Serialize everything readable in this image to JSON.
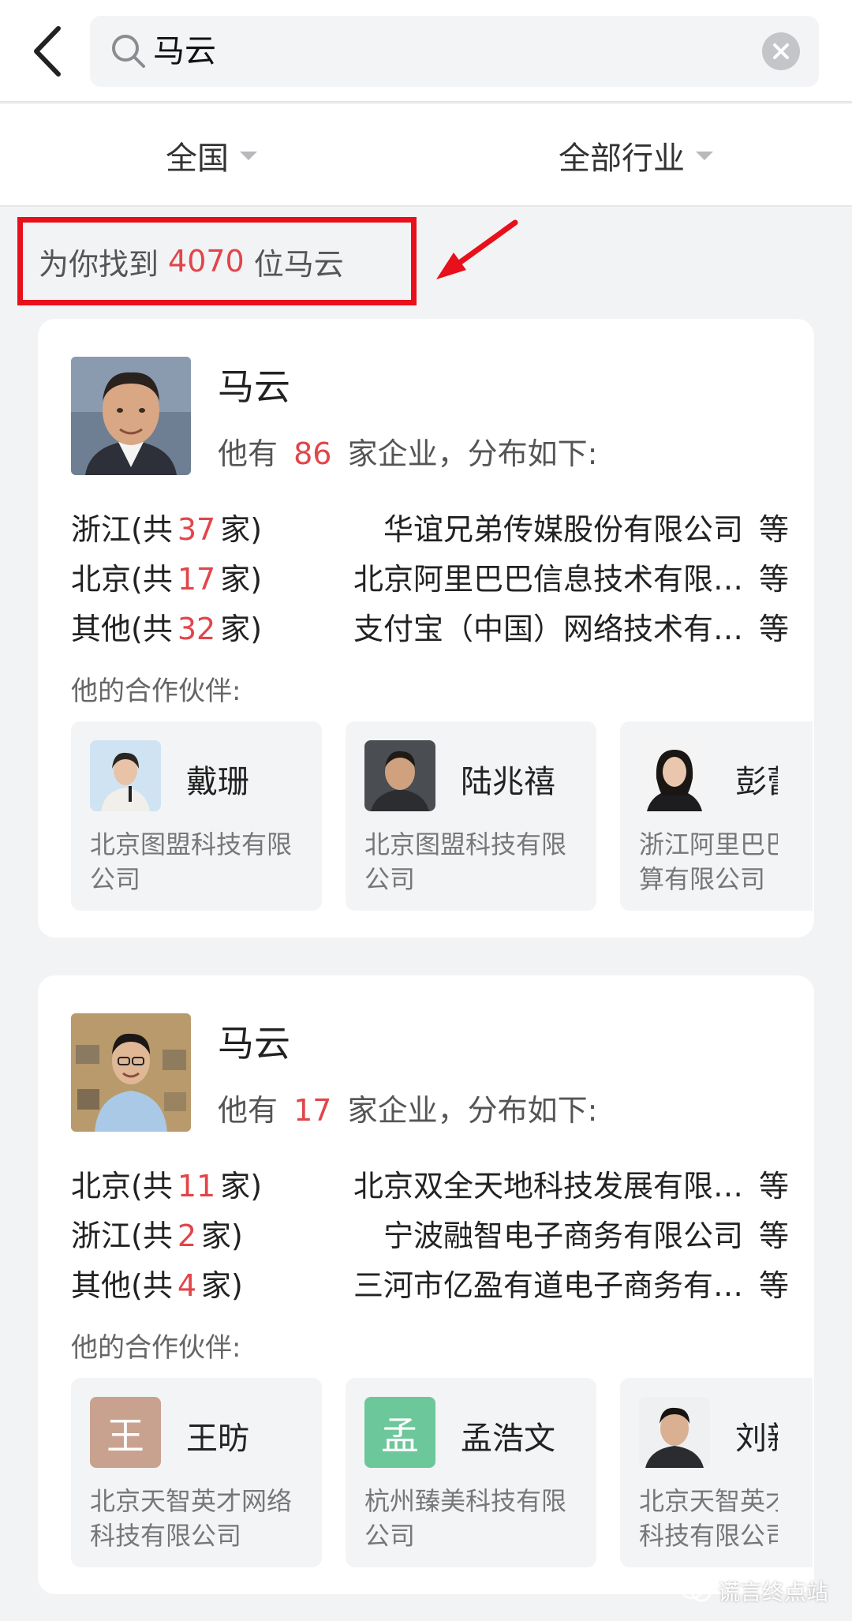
{
  "search": {
    "query": "马云"
  },
  "filters": {
    "region": "全国",
    "industry": "全部行业"
  },
  "result": {
    "prefix": "为你找到",
    "count": "4070",
    "suffix": "位马云"
  },
  "cards": [
    {
      "name": "马云",
      "summary_prefix": "他有",
      "enterprise_count": "86",
      "summary_suffix": "家企业，分布如下:",
      "distribution": [
        {
          "region": "浙江(共",
          "count": "37",
          "unit": "家)",
          "company": "华谊兄弟传媒股份有限公司",
          "etc": "等"
        },
        {
          "region": "北京(共",
          "count": "17",
          "unit": "家)",
          "company": "北京阿里巴巴信息技术有限…",
          "etc": "等"
        },
        {
          "region": "其他(共",
          "count": "32",
          "unit": "家)",
          "company": "支付宝（中国）网络技术有…",
          "etc": "等"
        }
      ],
      "partners_label": "他的合作伙伴:",
      "partners": [
        {
          "name": "戴珊",
          "company": "北京图盟科技有限公司"
        },
        {
          "name": "陆兆禧",
          "company": "北京图盟科技有限公司"
        },
        {
          "name": "彭蕾",
          "company": "浙江阿里巴巴云计算有限公司"
        }
      ]
    },
    {
      "name": "马云",
      "summary_prefix": "他有",
      "enterprise_count": "17",
      "summary_suffix": "家企业，分布如下:",
      "distribution": [
        {
          "region": "北京(共",
          "count": "11",
          "unit": "家)",
          "company": "北京双全天地科技发展有限…",
          "etc": "等"
        },
        {
          "region": "浙江(共",
          "count": "2",
          "unit": "家)",
          "company": "宁波融智电子商务有限公司",
          "etc": "等"
        },
        {
          "region": "其他(共",
          "count": "4",
          "unit": "家)",
          "company": "三河市亿盈有道电子商务有…",
          "etc": "等"
        }
      ],
      "partners_label": "他的合作伙伴:",
      "partners": [
        {
          "name": "王昉",
          "avatar_char": "王",
          "avatar_color": "#c9a28f",
          "company": "北京天智英才网络科技有限公司"
        },
        {
          "name": "孟浩文",
          "avatar_char": "孟",
          "avatar_color": "#6cc79b",
          "company": "杭州臻美科技有限公司"
        },
        {
          "name": "刘新",
          "company": "北京天智英才网络科技有限公司"
        }
      ]
    }
  ],
  "watermark": {
    "text": "谎言终点站"
  },
  "colors": {
    "accent_red": "#e2454a",
    "highlight_box": "#e8101a",
    "background": "#f2f3f5"
  }
}
